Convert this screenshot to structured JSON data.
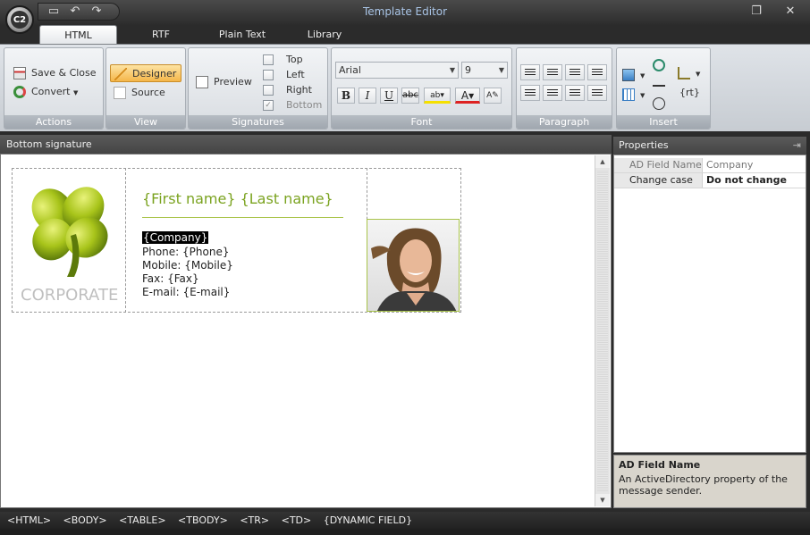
{
  "window": {
    "title": "Template Editor",
    "logo_text": "C2"
  },
  "quick_access": [
    "save-icon",
    "undo-icon",
    "redo-icon"
  ],
  "tabs": [
    {
      "label": "HTML",
      "active": true
    },
    {
      "label": "RTF"
    },
    {
      "label": "Plain Text"
    },
    {
      "label": "Library"
    }
  ],
  "ribbon": {
    "actions": {
      "caption": "Actions",
      "save_close": "Save & Close",
      "convert": "Convert"
    },
    "view": {
      "caption": "View",
      "designer": "Designer",
      "source": "Source"
    },
    "signatures": {
      "caption": "Signatures",
      "preview": "Preview",
      "top": "Top",
      "left": "Left",
      "right": "Right",
      "bottom": "Bottom"
    },
    "font": {
      "caption": "Font",
      "family": "Arial",
      "size": "9"
    },
    "paragraph": {
      "caption": "Paragraph"
    },
    "insert": {
      "caption": "Insert",
      "rt": "{rt}"
    }
  },
  "editor": {
    "header": "Bottom signature",
    "signature": {
      "logo_text": "CORPORATE",
      "name_line": "{First name} {Last name}",
      "company": "{Company}",
      "phone": "Phone: {Phone}",
      "mobile": "Mobile: {Mobile}",
      "fax": "Fax: {Fax}",
      "email": "E-mail: {E-mail}"
    }
  },
  "properties": {
    "header": "Properties",
    "rows": [
      {
        "key": "AD Field Name",
        "value": "Company"
      },
      {
        "key": "Change case",
        "value": "Do not change"
      }
    ],
    "description_title": "AD Field Name",
    "description_text": "An ActiveDirectory property of the message sender."
  },
  "statusbar": [
    "<HTML>",
    "<BODY>",
    "<TABLE>",
    "<TBODY>",
    "<TR>",
    "<TD>",
    "{DYNAMIC FIELD}"
  ],
  "colors": {
    "accent_green": "#6b9a1f",
    "name_green": "#7ba320",
    "highlight_orange": "#f5c04a",
    "title_blue": "#a9c4e6"
  }
}
